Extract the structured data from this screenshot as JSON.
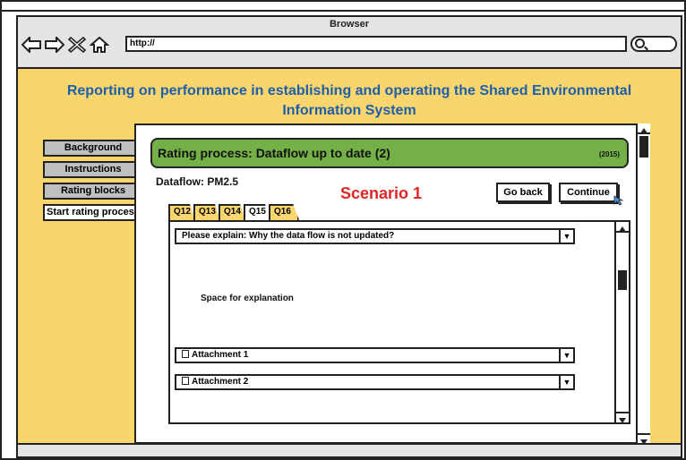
{
  "browser": {
    "title": "Browser",
    "url": "http://",
    "icons": [
      "back-arrow-icon",
      "forward-arrow-icon",
      "close-x-icon",
      "home-icon",
      "search-icon"
    ]
  },
  "page": {
    "title": "Reporting on performance in establishing and operating the Shared Environmental Information System"
  },
  "sidenav": {
    "items": [
      {
        "label": "Background"
      },
      {
        "label": "Instructions"
      },
      {
        "label": "Rating blocks"
      },
      {
        "label": "Start rating process"
      }
    ],
    "active": "Start rating process"
  },
  "rating": {
    "header": "Rating process: Dataflow up to date (2)",
    "year": "(2015)",
    "dataflow": "Dataflow: PM2.5",
    "scenario": "Scenario 1",
    "go_back": "Go back",
    "continue": "Continue"
  },
  "tabs": [
    "Q12",
    "Q13",
    "Q14",
    "Q15",
    "Q16"
  ],
  "active_tab": "Q15",
  "question": {
    "explain": "Please explain: Why the data flow is not updated?",
    "placeholder": "Space for explanation",
    "attachment1": "Attachment 1",
    "attachment2": "Attachment 2"
  },
  "colors": {
    "page_bg": "#f9d56e",
    "title": "#1f5fa8",
    "rating_header": "#74b048",
    "scenario": "#e32525"
  }
}
